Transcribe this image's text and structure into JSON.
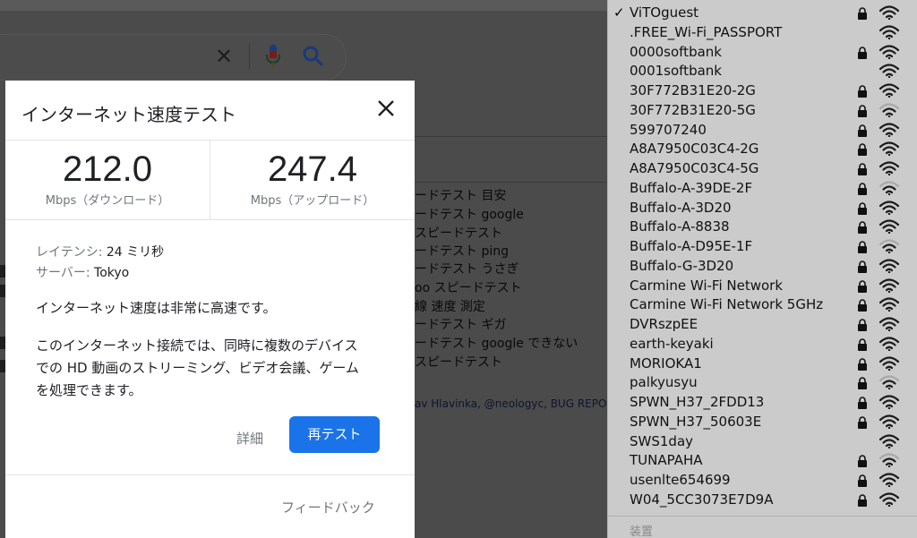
{
  "background": {
    "related_searches": [
      "ードテスト 目安",
      "ードテスト google",
      " スピードテスト",
      "ードテスト ping",
      "ードテスト うさぎ",
      "oo スピードテスト",
      "線 速度 測定",
      "ードテスト ギガ",
      "ードテスト google できない",
      "スピードテスト"
    ],
    "credit": "av Hlavinka, @neologyc, BUG REPOR"
  },
  "speedtest": {
    "title": "インターネット速度テスト",
    "download_value": "212.0",
    "download_unit": "Mbps（ダウンロード）",
    "upload_value": "247.4",
    "upload_unit": "Mbps（アップロード）",
    "latency_label": "レイテンシ: ",
    "latency_value": "24 ミリ秒",
    "server_label": "サーバー: ",
    "server_value": "Tokyo",
    "summary": "インターネット速度は非常に高速です。",
    "desc_line1": "このインターネット接続では、同時に複数のデバイス",
    "desc_line2": "での HD 動画のストリーミング、ビデオ会議、ゲーム",
    "desc_line3": "を処理できます。",
    "details_label": "詳細",
    "retest_label": "再テスト",
    "feedback_label": "フィードバック"
  },
  "wifi": {
    "networks": [
      {
        "name": "ViTOguest",
        "selected": true,
        "locked": true,
        "strength": 3
      },
      {
        "name": ".FREE_Wi-Fi_PASSPORT",
        "selected": false,
        "locked": false,
        "strength": 3
      },
      {
        "name": "0000softbank",
        "selected": false,
        "locked": true,
        "strength": 3
      },
      {
        "name": "0001softbank",
        "selected": false,
        "locked": false,
        "strength": 3
      },
      {
        "name": "30F772B31E20-2G",
        "selected": false,
        "locked": true,
        "strength": 3
      },
      {
        "name": "30F772B31E20-5G",
        "selected": false,
        "locked": true,
        "strength": 2
      },
      {
        "name": "599707240",
        "selected": false,
        "locked": true,
        "strength": 3
      },
      {
        "name": "A8A7950C03C4-2G",
        "selected": false,
        "locked": true,
        "strength": 3
      },
      {
        "name": "A8A7950C03C4-5G",
        "selected": false,
        "locked": true,
        "strength": 3
      },
      {
        "name": "Buffalo-A-39DE-2F",
        "selected": false,
        "locked": true,
        "strength": 2
      },
      {
        "name": "Buffalo-A-3D20",
        "selected": false,
        "locked": true,
        "strength": 3
      },
      {
        "name": "Buffalo-A-8838",
        "selected": false,
        "locked": true,
        "strength": 3
      },
      {
        "name": "Buffalo-A-D95E-1F",
        "selected": false,
        "locked": true,
        "strength": 2
      },
      {
        "name": "Buffalo-G-3D20",
        "selected": false,
        "locked": true,
        "strength": 3
      },
      {
        "name": "Carmine Wi-Fi Network",
        "selected": false,
        "locked": true,
        "strength": 3
      },
      {
        "name": "Carmine Wi-Fi Network 5GHz",
        "selected": false,
        "locked": true,
        "strength": 3
      },
      {
        "name": "DVRszpEE",
        "selected": false,
        "locked": true,
        "strength": 3
      },
      {
        "name": "earth-keyaki",
        "selected": false,
        "locked": true,
        "strength": 3
      },
      {
        "name": "MORIOKA1",
        "selected": false,
        "locked": true,
        "strength": 3
      },
      {
        "name": "palkyusyu",
        "selected": false,
        "locked": true,
        "strength": 2
      },
      {
        "name": "SPWN_H37_2FDD13",
        "selected": false,
        "locked": true,
        "strength": 3
      },
      {
        "name": "SPWN_H37_50603E",
        "selected": false,
        "locked": true,
        "strength": 3
      },
      {
        "name": "SWS1day",
        "selected": false,
        "locked": false,
        "strength": 3
      },
      {
        "name": "TUNAPAHA",
        "selected": false,
        "locked": true,
        "strength": 2
      },
      {
        "name": "usenlte654699",
        "selected": false,
        "locked": true,
        "strength": 3
      },
      {
        "name": "W04_5CC3073E7D9A",
        "selected": false,
        "locked": true,
        "strength": 3
      }
    ],
    "section_label": "装置"
  },
  "colors": {
    "accent": "#1a73e8",
    "overlay": "#4b4b4b",
    "menu_bg": "#cbcbcb"
  }
}
